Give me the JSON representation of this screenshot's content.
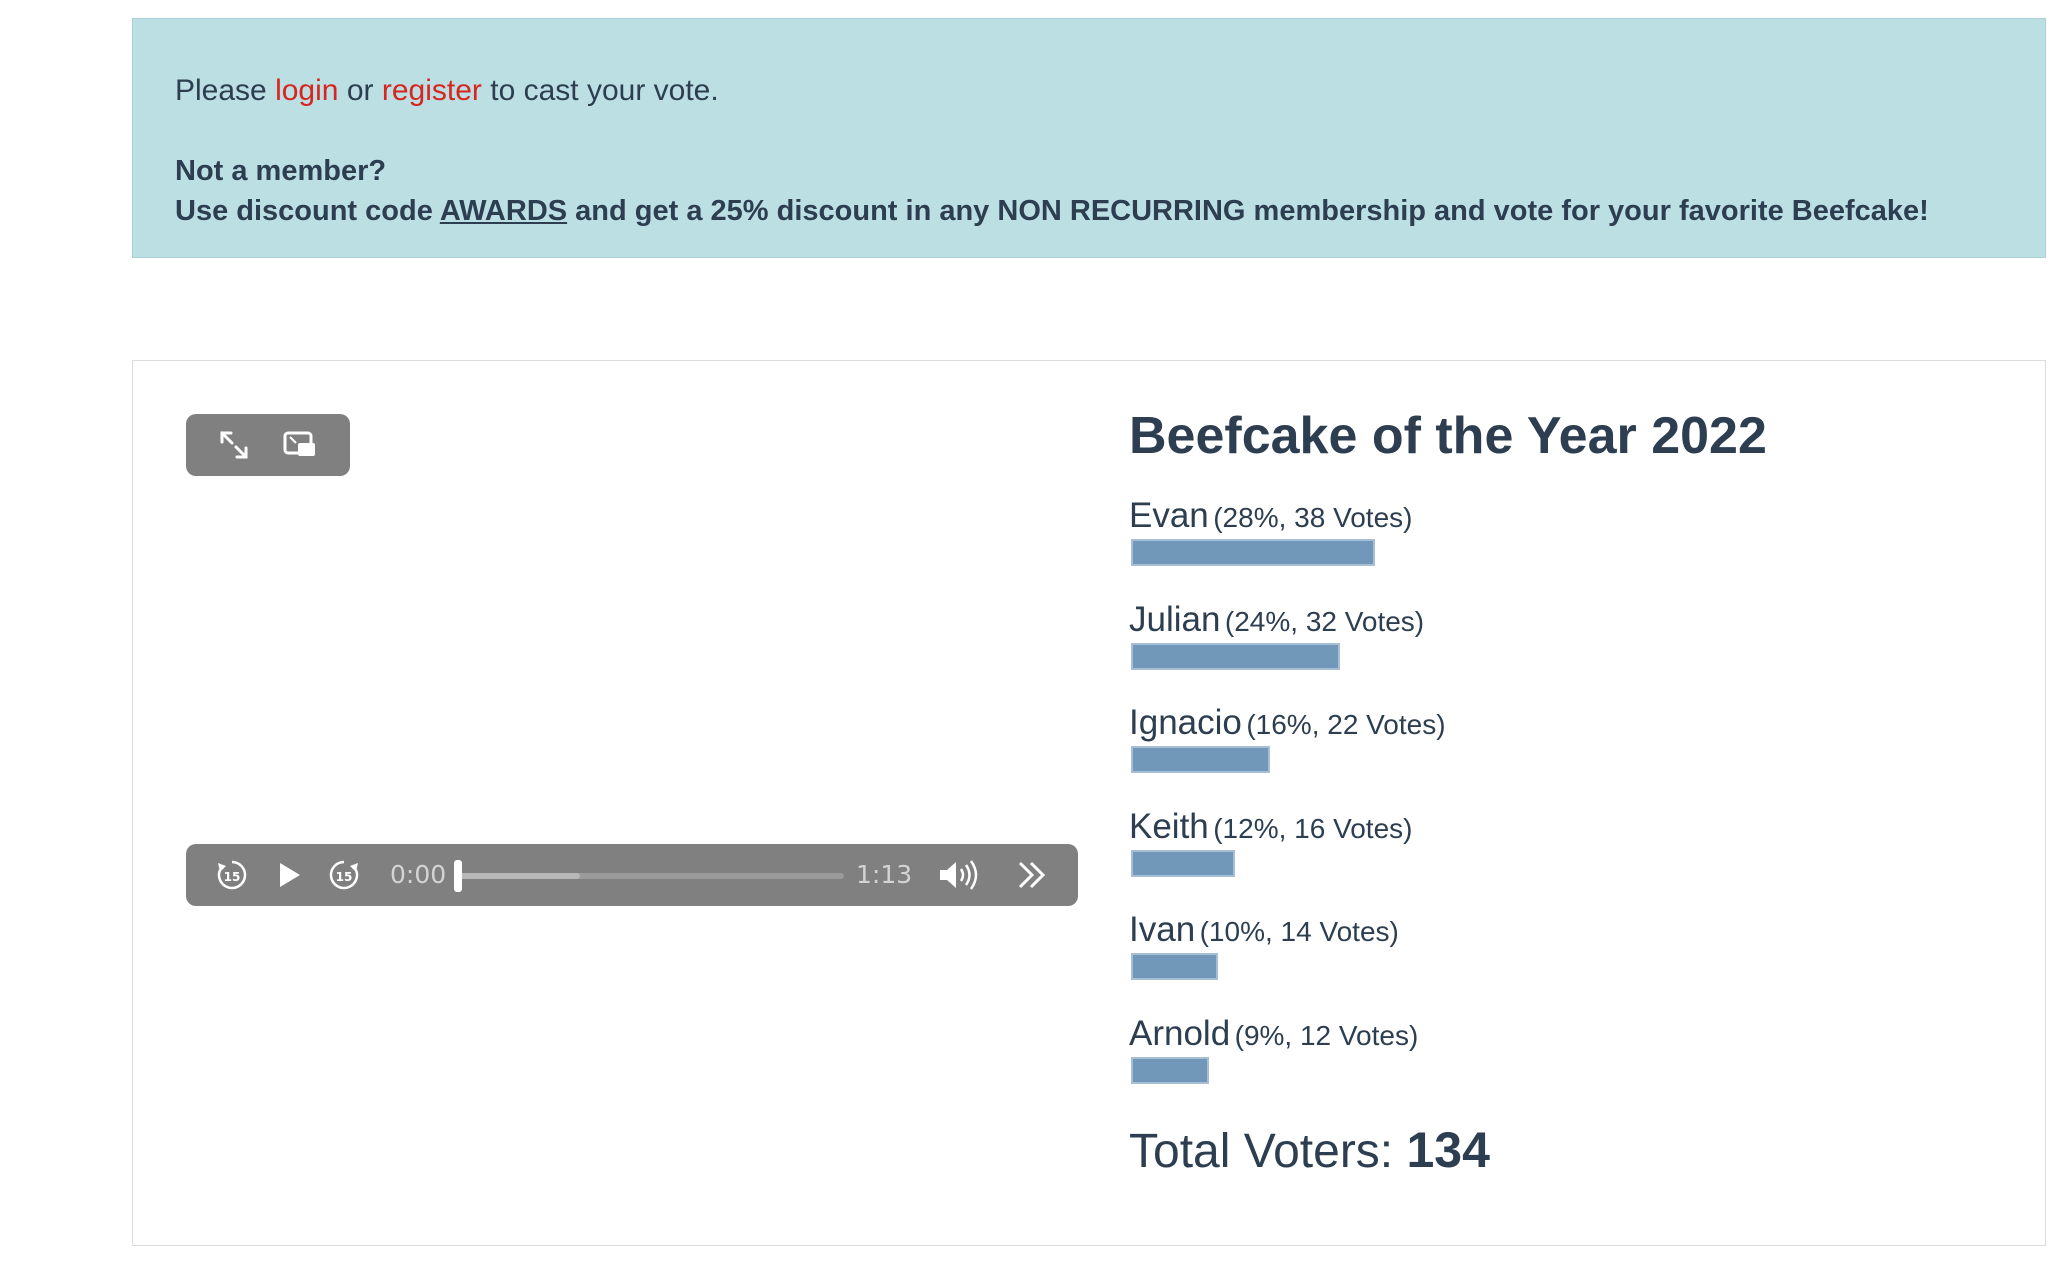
{
  "notice": {
    "prefix": "Please",
    "login_label": "login",
    "or_text": "or",
    "register_label": "register",
    "suffix": "to cast your vote.",
    "not_member": "Not a member?",
    "discount_pre": "Use discount code",
    "discount_code": "AWARDS",
    "discount_post": "and get a 25% discount in any NON RECURRING membership and vote for your favorite Beefcake!"
  },
  "video": {
    "current_time": "0:00",
    "duration": "1:13",
    "progress_fraction": 0.0,
    "buffered_fraction": 0.32,
    "icons": {
      "fullscreen": "fullscreen-icon",
      "pip": "picture-in-picture-icon",
      "rewind": "rewind-15-icon",
      "play": "play-icon",
      "forward": "forward-15-icon",
      "volume": "volume-icon",
      "more": "more-controls-icon"
    }
  },
  "poll": {
    "title": "Beefcake of the Year 2022",
    "bar_color": "#7198b8",
    "items": [
      {
        "name": "Evan",
        "stats": "(28%, 38 Votes)",
        "percent": 28
      },
      {
        "name": "Julian",
        "stats": "(24%, 32 Votes)",
        "percent": 24
      },
      {
        "name": "Ignacio",
        "stats": "(16%, 22 Votes)",
        "percent": 16
      },
      {
        "name": "Keith",
        "stats": "(12%, 16 Votes)",
        "percent": 12
      },
      {
        "name": "Ivan",
        "stats": "(10%, 14 Votes)",
        "percent": 10
      },
      {
        "name": "Arnold",
        "stats": "(9%, 12 Votes)",
        "percent": 9
      }
    ],
    "total_label": "Total Voters:",
    "total_value": "134"
  }
}
